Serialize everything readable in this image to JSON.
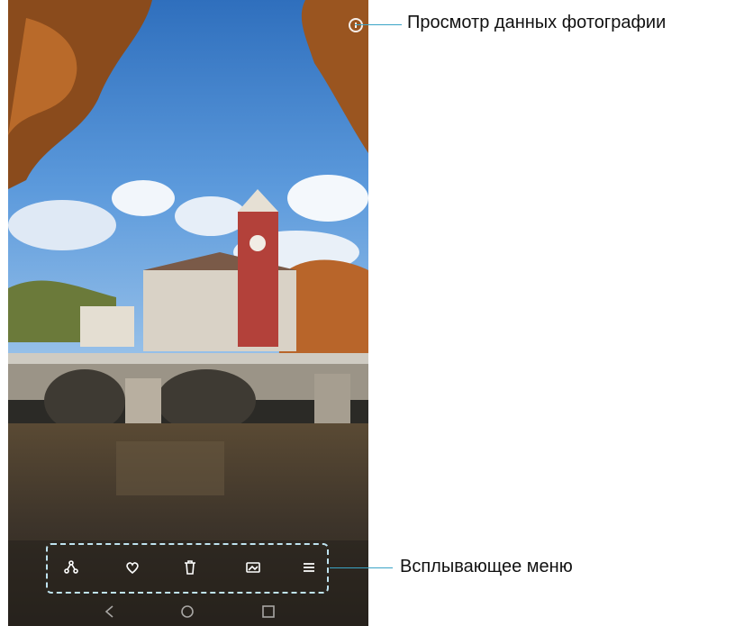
{
  "annotations": {
    "photo_details": "Просмотр данных фотографии",
    "popup_menu": "Всплывающее меню"
  },
  "toolbar": {
    "items": [
      {
        "icon": "share-icon"
      },
      {
        "icon": "favorite-icon"
      },
      {
        "icon": "delete-icon"
      },
      {
        "icon": "edit-icon"
      },
      {
        "icon": "more-icon"
      }
    ]
  },
  "navbar": {
    "items": [
      {
        "icon": "back-icon"
      },
      {
        "icon": "home-icon"
      },
      {
        "icon": "recents-icon"
      }
    ]
  },
  "colors": {
    "callout_line": "#3aa4c6",
    "menu_frame": "#bfe3f0"
  }
}
